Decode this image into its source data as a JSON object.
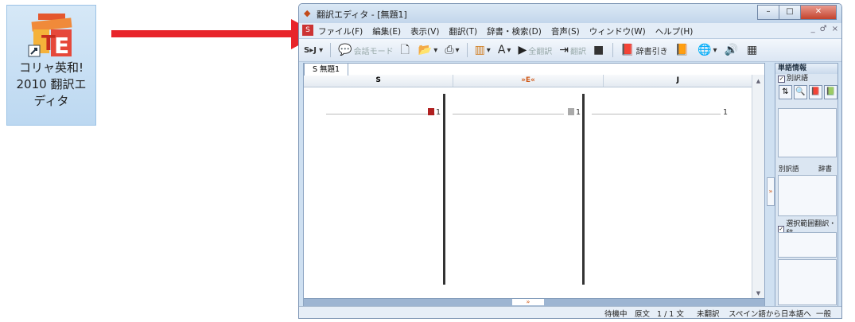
{
  "desktop_icon": {
    "label": "コリャ英和!\n2010 翻訳エ\nディタ"
  },
  "window": {
    "title": "翻訳エディタ - [無題1]",
    "controls": {
      "minimize": "–",
      "maximize": "□",
      "close": "✕"
    }
  },
  "menu": {
    "items": [
      "ファイル(F)",
      "編集(E)",
      "表示(V)",
      "翻訳(T)",
      "辞書・検索(D)",
      "音声(S)",
      "ウィンドウ(W)",
      "ヘルプ(H)"
    ],
    "mdi": [
      "_",
      "♂",
      "×"
    ]
  },
  "toolbar": {
    "lang_button": "S▸J",
    "conversation_mode": "会話モード",
    "translate_all": "全翻訳",
    "translate_back": "翻訳",
    "dict_lookup": "辞書引き"
  },
  "document": {
    "tab": "S 無題1",
    "columns": [
      "S",
      "»E«",
      "J"
    ],
    "row_numbers": [
      "1",
      "1",
      "1"
    ]
  },
  "panel": {
    "title": "単語情報",
    "alt_check": "別訳語",
    "alt_label": "別訳語",
    "dict_label": "辞書",
    "range_check": "選択範囲翻訳・辞"
  },
  "status": {
    "state": "待機中",
    "original": "原文",
    "counter": "1 / 1 文",
    "untranslated": "未翻訳",
    "direction": "スペイン語から日本語へ",
    "category": "一般"
  },
  "colors": {
    "accent_red": "#e8242a",
    "window_frame": "#cfe0f1"
  }
}
